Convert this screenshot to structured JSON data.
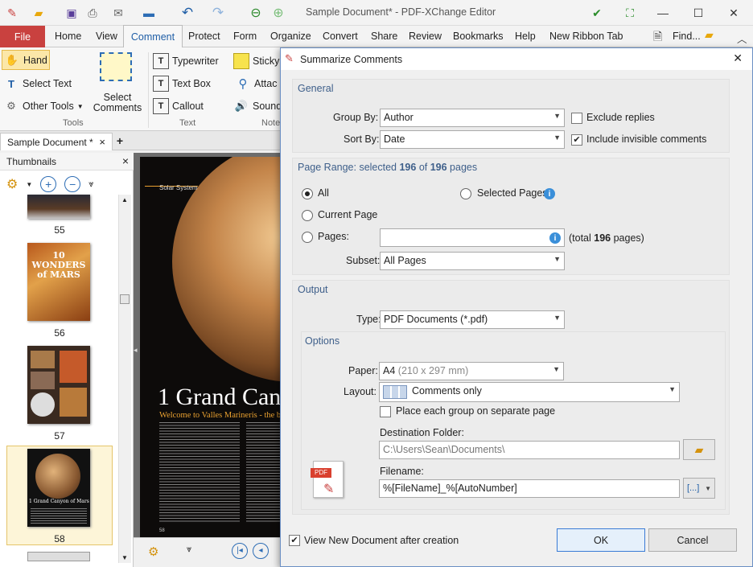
{
  "window": {
    "title": "Sample Document* - PDF-XChange Editor",
    "minimize_glyph": "—",
    "maximize_glyph": "☐",
    "close_glyph": "✕"
  },
  "menu": {
    "items": [
      "File",
      "Home",
      "View",
      "Comment",
      "Protect",
      "Form",
      "Organize",
      "Convert",
      "Share",
      "Review",
      "Bookmarks",
      "Help",
      "New Ribbon Tab"
    ],
    "find_label": "Find...",
    "active": "Comment",
    "file_color": "#c9413f",
    "accent": "#1f5ea6"
  },
  "ribbon": {
    "tools": {
      "hand": "Hand",
      "select_text": "Select Text",
      "other_tools": "Other Tools",
      "select_comments": "Select\nComments",
      "label": "Tools"
    },
    "text": {
      "typewriter": "Typewriter",
      "text_box": "Text Box",
      "callout": "Callout",
      "label": "Text"
    },
    "note": {
      "sticky": "Sticky",
      "attach": "Attac",
      "sound": "Sound",
      "label": "Note"
    }
  },
  "doc_tab": {
    "label": "Sample Document *",
    "close": "×",
    "add": "+"
  },
  "thumbnails": {
    "title": "Thumbnails",
    "close": "×",
    "pages": [
      "55",
      "56",
      "57",
      "58"
    ],
    "cover_title_56": "10\nWONDERS\nof MARS",
    "cover_title_58": "1 Grand Canyon of Mars"
  },
  "page": {
    "section": "Solar System",
    "headline": "1 Grand Can",
    "subhead": "Welcome to Valles Marineris - the b",
    "page_num": "58"
  },
  "dialog": {
    "title": "Summarize Comments",
    "close": "✕",
    "general": {
      "title": "General",
      "group_by_label": "Group By:",
      "group_by_value": "Author",
      "sort_by_label": "Sort By:",
      "sort_by_value": "Date",
      "exclude_replies": "Exclude replies",
      "exclude_replies_checked": false,
      "include_invisible": "Include invisible comments",
      "include_invisible_checked": true
    },
    "page_range": {
      "title_prefix": "Page Range: selected ",
      "selected": "196",
      "of": " of ",
      "total": "196",
      "title_suffix": " pages",
      "all": "All",
      "current_page": "Current Page",
      "pages": "Pages:",
      "selected_pages": "Selected Pages",
      "pages_value": "",
      "total_prefix": "(total ",
      "total_count": "196",
      "total_suffix": " pages)",
      "subset_label": "Subset:",
      "subset_value": "All Pages",
      "selected_option": "All"
    },
    "output": {
      "title": "Output",
      "type_label": "Type:",
      "type_value": "PDF Documents (*.pdf)",
      "options_title": "Options",
      "paper_label": "Paper:",
      "paper_value": "A4",
      "paper_dims": "(210 x 297 mm)",
      "layout_label": "Layout:",
      "layout_value": "Comments only",
      "each_group": "Place each group on separate page",
      "each_group_checked": false,
      "dest_label": "Destination Folder:",
      "dest_value": "C:\\Users\\Sean\\Documents\\",
      "filename_label": "Filename:",
      "filename_value": "%[FileName]_%[AutoNumber]",
      "macro_btn": "[...]"
    },
    "footer": {
      "view_new": "View New Document after creation",
      "view_new_checked": true,
      "ok": "OK",
      "cancel": "Cancel"
    }
  }
}
